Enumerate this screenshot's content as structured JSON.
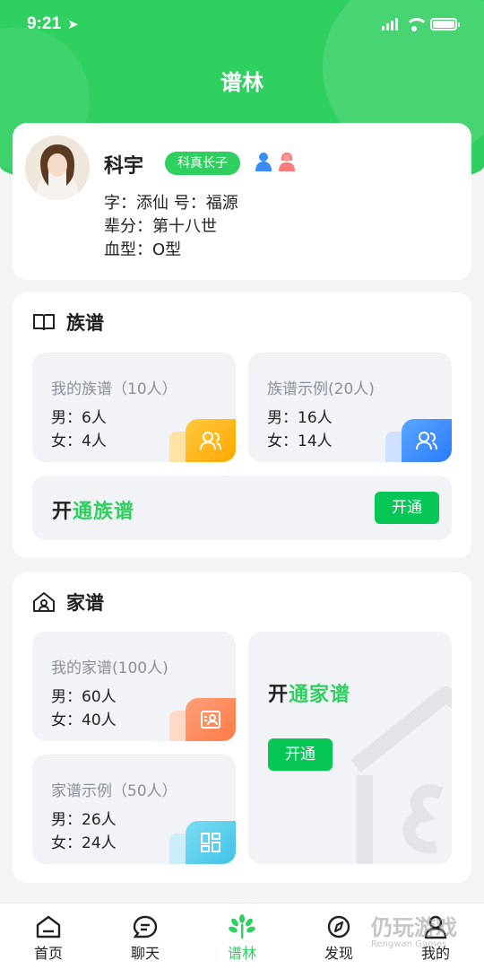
{
  "status_bar": {
    "time": "9:21"
  },
  "header": {
    "title": "谱林"
  },
  "profile": {
    "name": "科宇",
    "badge": "科真长子",
    "zi_line": "字：添仙   号：福源",
    "generation_line": "辈分：第十八世",
    "blood_line": "血型：O型"
  },
  "zupu": {
    "heading": "族谱",
    "mine": {
      "label": "我的族谱（10人）",
      "male": "男：6人",
      "female": "女：4人"
    },
    "example": {
      "label": "族谱示例(20人)",
      "male": "男：16人",
      "female": "女：14人"
    },
    "open": {
      "prefix": "开",
      "suffix": "通族谱",
      "button": "开通"
    }
  },
  "jiapu": {
    "heading": "家谱",
    "mine": {
      "label": "我的家谱(100人)",
      "male": "男：60人",
      "female": "女：40人"
    },
    "example": {
      "label": "家谱示例（50人）",
      "male": "男：26人",
      "female": "女：24人"
    },
    "open": {
      "prefix": "开",
      "suffix": "通家谱",
      "button": "开通"
    }
  },
  "tabbar": {
    "items": [
      {
        "label": "首页",
        "icon": "home-icon"
      },
      {
        "label": "聊天",
        "icon": "chat-icon"
      },
      {
        "label": "谱林",
        "icon": "tree-icon"
      },
      {
        "label": "发现",
        "icon": "compass-icon"
      },
      {
        "label": "我的",
        "icon": "user-icon"
      }
    ],
    "active_index": 2
  },
  "watermark": {
    "text": "仍玩游戏",
    "sub": "Rengwan Games"
  },
  "colors": {
    "brand_green": "#2fcf60",
    "button_green": "#06c755",
    "orange": "#ffb300",
    "blue": "#3a8dff",
    "coral": "#ff8a5c",
    "cyan": "#5ad1ee"
  }
}
